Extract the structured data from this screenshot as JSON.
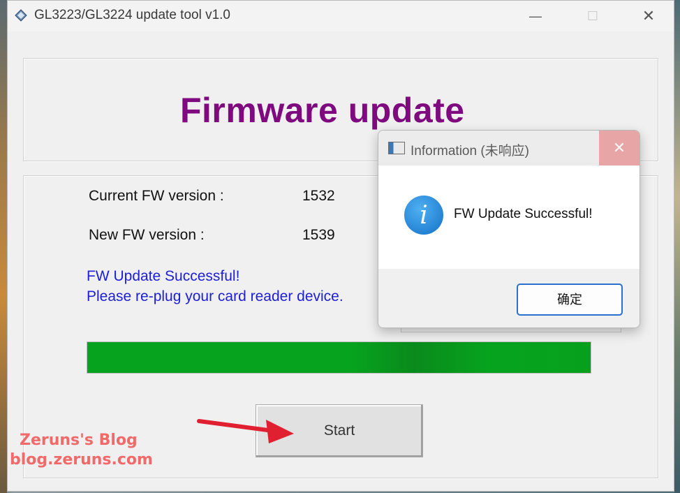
{
  "window": {
    "title": "GL3223/GL3224 update tool v1.0",
    "controls": {
      "minimize": "—",
      "maximize": "☐",
      "close": "✕"
    }
  },
  "header": {
    "headline": "Firmware update"
  },
  "info": {
    "current_label": "Current FW version :",
    "current_value": "1532",
    "new_label": "New FW version :",
    "new_value": "1539"
  },
  "status": {
    "line1": "FW Update Successful!",
    "line2": "Please re-plug your card reader device.",
    "color": "#1d20d6"
  },
  "progress": {
    "fraction": 1.0,
    "color": "#06a41e"
  },
  "actions": {
    "start_label": "Start"
  },
  "watermark": {
    "line1": "Zeruns's Blog",
    "line2": "blog.zeruns.com"
  },
  "dialog": {
    "title": "Information (未响应)",
    "close": "✕",
    "icon": "info-icon",
    "message": "FW Update Successful!",
    "ok_label": "确定"
  },
  "colors": {
    "headline": "#7f0a7f",
    "accent": "#2b6fcf",
    "annotation_arrow": "#e02030"
  }
}
